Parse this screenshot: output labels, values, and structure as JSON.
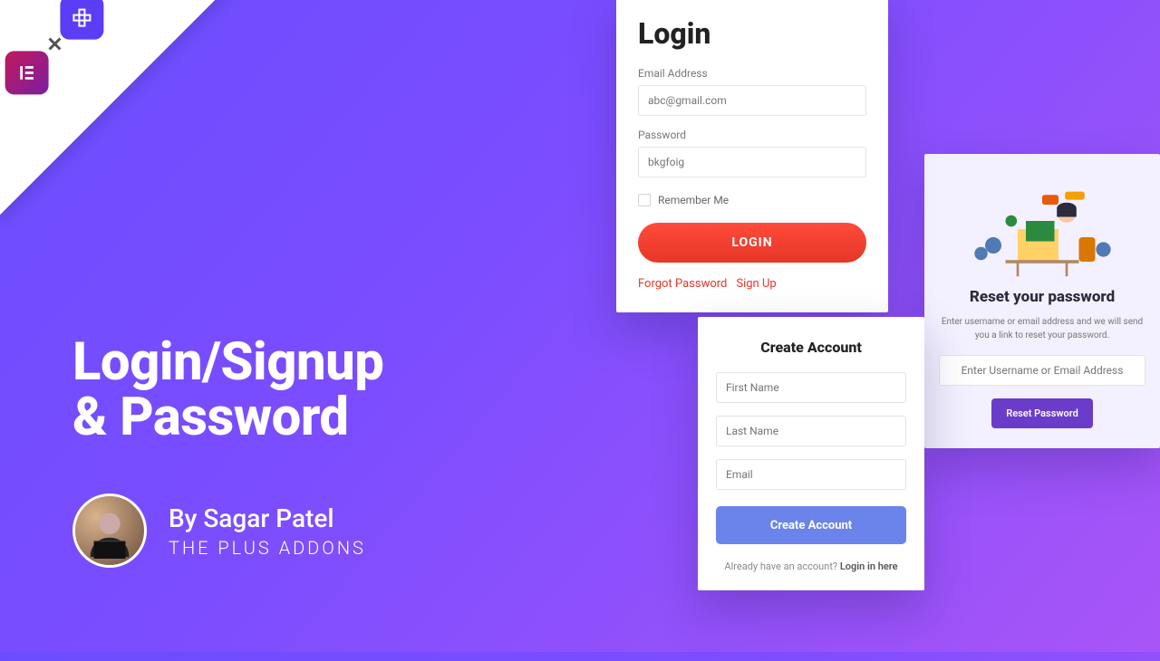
{
  "headline": {
    "line1": "Login/Signup",
    "line2": "& Password"
  },
  "byline": {
    "who": "By Sagar Patel",
    "brand": "THE PLUS ADDONS"
  },
  "login": {
    "title": "Login",
    "email_label": "Email Address",
    "email_placeholder": "abc@gmail.com",
    "password_label": "Password",
    "password_placeholder": "bkgfoig",
    "remember": "Remember Me",
    "button": "LOGIN",
    "forgot": "Forgot Password",
    "signup": "Sign Up"
  },
  "reset": {
    "title": "Reset your password",
    "desc": "Enter username or email address and we will send you a link to reset your password.",
    "placeholder": "Enter Username or Email Address",
    "button": "Reset Password"
  },
  "create": {
    "title": "Create Account",
    "first_placeholder": "First Name",
    "last_placeholder": "Last Name",
    "email_placeholder": "Email",
    "button": "Create Account",
    "already_text": "Already have an account? ",
    "already_link": "Login in here"
  }
}
